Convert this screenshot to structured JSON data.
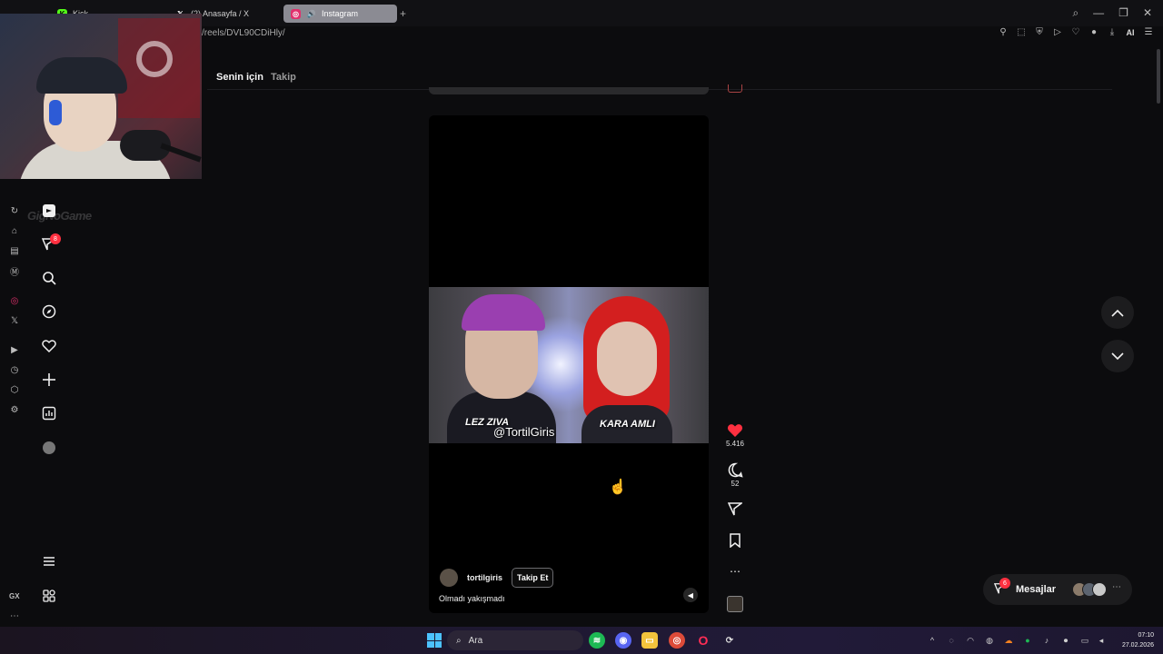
{
  "browser": {
    "tabs": [
      {
        "label": "Kick",
        "icon": "kick-icon"
      },
      {
        "label": "(2) Anasayfa / X",
        "icon": "x-icon"
      },
      {
        "label": "Instagram",
        "icon": "instagram-icon"
      }
    ],
    "url": "/reels/DVL90CDiHly/",
    "ai_label": "AI"
  },
  "gx": {
    "label": "GX"
  },
  "overlay": {
    "brand": "GigNoGame"
  },
  "ig_nav": {
    "notification_count": "8"
  },
  "reels": {
    "tabs": [
      {
        "label": "Senin için",
        "active": true
      },
      {
        "label": "Takip",
        "active": false
      }
    ]
  },
  "video": {
    "caption_left": "LEZ ZIVA",
    "caption_right": "KARA AMLI",
    "caption_handle": "@TortilGiris",
    "author": "tortilgiris",
    "follow_label": "Takip Et",
    "description": "Olmadı yakışmadı"
  },
  "actions": {
    "likes": "5.416",
    "comments": "52"
  },
  "messages": {
    "label": "Mesajlar",
    "unread": "6"
  },
  "taskbar": {
    "search_placeholder": "Ara",
    "time": "07:10",
    "date": "27.02.2026"
  },
  "colors": {
    "like": "#ff3040",
    "accent_blue": "#4cc2ff",
    "background": "#0c0c0e"
  }
}
